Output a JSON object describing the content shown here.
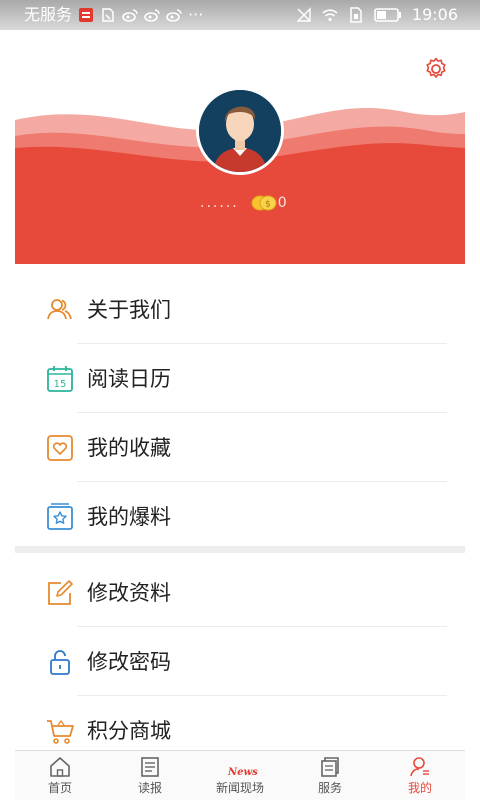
{
  "status_bar": {
    "carrier": "无服务",
    "time": "19:06",
    "icons": [
      "news-app-icon",
      "sim-icon",
      "weibo-icon",
      "weibo-icon",
      "weibo-icon",
      "more-dots",
      "no-signal-icon",
      "wifi-icon",
      "sim-card-icon",
      "battery-icon"
    ],
    "more": "···"
  },
  "profile": {
    "nickname": "......",
    "coin_count": "0"
  },
  "menu_group1": [
    {
      "label": "关于我们",
      "icon": "about-us-icon"
    },
    {
      "label": "阅读日历",
      "icon": "calendar-icon",
      "calendar_day": "15"
    },
    {
      "label": "我的收藏",
      "icon": "favorites-heart-icon"
    },
    {
      "label": "我的爆料",
      "icon": "tip-off-star-icon"
    }
  ],
  "menu_group2": [
    {
      "label": "修改资料",
      "icon": "edit-profile-icon"
    },
    {
      "label": "修改密码",
      "icon": "lock-icon"
    },
    {
      "label": "积分商城",
      "icon": "shopping-cart-icon"
    }
  ],
  "tabbar": {
    "tabs": [
      {
        "label": "首页",
        "icon": "home-icon"
      },
      {
        "label": "读报",
        "icon": "newspaper-icon"
      },
      {
        "label": "新闻现场",
        "icon": "news-live-icon",
        "icon_text": "News"
      },
      {
        "label": "服务",
        "icon": "service-icon"
      },
      {
        "label": "我的",
        "icon": "user-icon",
        "active": true
      }
    ]
  },
  "colors": {
    "brand_red": "#e74a3b",
    "wave_light": "#f28e84",
    "icon_orange": "#e68a2e",
    "icon_teal": "#2bb59b",
    "icon_blue": "#2f77c9"
  }
}
